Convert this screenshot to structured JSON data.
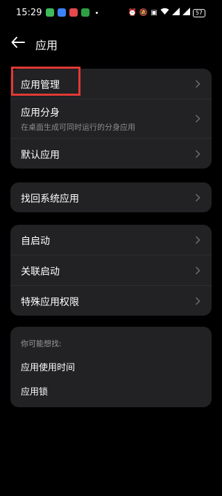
{
  "status": {
    "time": "15:29",
    "battery": "57",
    "app_icon_colors": [
      "#3dbb5c",
      "#3b82f6",
      "#e5484d",
      "#2ea043"
    ],
    "sys_icons": [
      "alarm-icon",
      "mute-icon",
      "hd-icon",
      "wifi-icon",
      "signal-icon",
      "signal-icon"
    ]
  },
  "header": {
    "title": "应用"
  },
  "group1": {
    "items": [
      {
        "label": "应用管理"
      },
      {
        "label": "应用分身",
        "sub": "在桌面生成可同时运行的分身应用"
      },
      {
        "label": "默认应用"
      }
    ]
  },
  "group2": {
    "items": [
      {
        "label": "找回系统应用"
      }
    ]
  },
  "group3": {
    "items": [
      {
        "label": "自启动"
      },
      {
        "label": "关联启动"
      },
      {
        "label": "特殊应用权限"
      }
    ]
  },
  "hints": {
    "title": "你可能想找:",
    "items": [
      "应用使用时间",
      "应用锁"
    ]
  },
  "colors": {
    "card_bg": "#222224",
    "highlight": "#e53935"
  }
}
